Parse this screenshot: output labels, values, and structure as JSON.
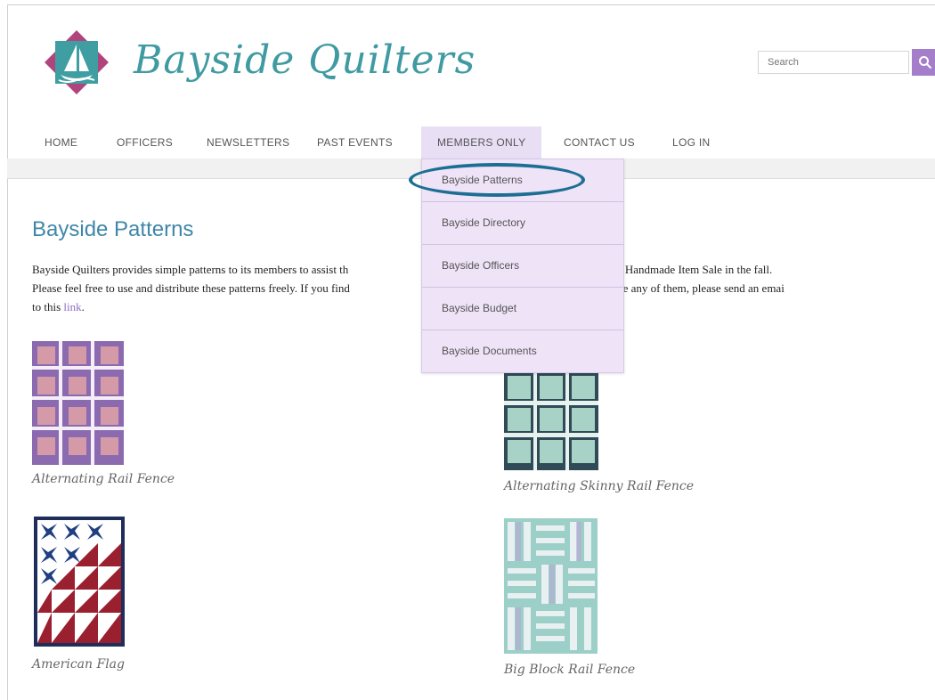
{
  "header": {
    "site_title": "Bayside Quilters",
    "search_placeholder": "Search"
  },
  "nav": {
    "items": [
      "HOME",
      "OFFICERS",
      "NEWSLETTERS",
      "PAST EVENTS",
      "MEMBERS ONLY",
      "CONTACT US",
      "LOG IN"
    ],
    "active": "MEMBERS ONLY"
  },
  "dropdown": {
    "items": [
      "Bayside Patterns",
      "Bayside Directory",
      "Bayside Officers",
      "Bayside Budget",
      "Bayside Documents"
    ],
    "highlighted": "Bayside Patterns"
  },
  "page": {
    "title": "Bayside Patterns",
    "intro_line1_a": "Bayside Quilters provides simple patterns to its members to assist th",
    "intro_line1_b": "h program and for the Handmade Item Sale in the fall.",
    "intro_line2_a": "Please feel free to use and distribute these patterns freely. If you find",
    "intro_line2_b": "uggestion to improve any of them, please send an emai",
    "intro_line3": "to this ",
    "intro_link": "link",
    "intro_end": "."
  },
  "patterns": [
    {
      "label": "Alternating Rail Fence"
    },
    {
      "label": "Alternating Skinny Rail Fence"
    },
    {
      "label": "American Flag"
    },
    {
      "label": "Big Block Rail Fence"
    }
  ],
  "colors": {
    "accent_purple": "#a57ecb",
    "title_teal": "#3f9aa1",
    "dropdown_bg": "#eee3f7",
    "highlight_ring": "#1d6e93"
  }
}
